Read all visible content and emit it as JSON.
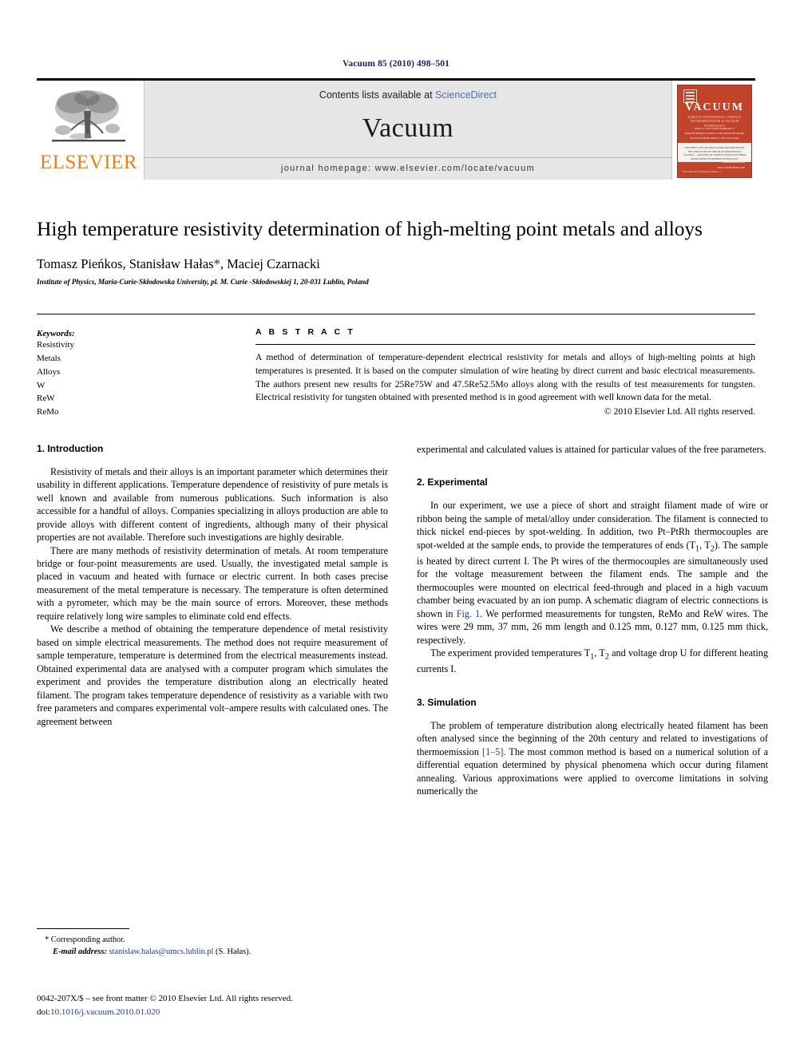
{
  "running_head": "Vacuum 85 (2010) 498–501",
  "masthead": {
    "elsevier_wordmark": "ELSEVIER",
    "contents_prefix": "Contents lists available at ",
    "sciencedirect": "ScienceDirect",
    "journal_title": "Vacuum",
    "homepage": "journal homepage: www.elsevier.com/locate/vacuum",
    "cover": {
      "title": "VACUUM",
      "subtitle": "SURFACE ENGINEERING, SURFACE INSTRUMENTATION & VACUUM TECHNOLOGY",
      "editors": "JOHN A. COLLIGON    BARBARA J. PROKHORENKO    DAVID P. FIELDMAN    RICHARD BLOODWORTH    DENIS J. MCWILLIAMS",
      "blurb": "THE EFFECT OF IONS AND PLASMA PARAMETERS ON THE STRUCTURE OF THIN FILMS DEPOSITED IN VACUUM — ANALYSIS OF SURFACE STATES AND THEIR APPLICATIONS IN MODERN TECHNOLOGY",
      "available_label": "Available online at",
      "sciencedirect": "ScienceDirect",
      "site": "www.sciencedirect.com",
      "issn_line": "ISSN 0042-207X    Volume 85    Number 4"
    }
  },
  "article": {
    "title": "High temperature resistivity determination of high-melting point metals and alloys",
    "authors_pre": "Tomasz Pieńkos, Stanisław Hałas",
    "author_star": "*",
    "authors_post": ", Maciej Czarnacki",
    "affiliation": "Institute of Physics, Maria-Curie-Skłodowska University, pl. M. Curie -Skłodowskiej 1, 20-031 Lublin, Poland"
  },
  "keywords": {
    "heading": "Keywords:",
    "items": [
      "Resistivity",
      "Metals",
      "Alloys",
      "W",
      "ReW",
      "ReMo"
    ]
  },
  "abstract": {
    "heading": "A B S T R A C T",
    "text": "A method of determination of temperature-dependent electrical resistivity for metals and alloys of high-melting points at high temperatures is presented. It is based on the computer simulation of wire heating by direct current and basic electrical measurements. The authors present new results for 25Re75W and 47.5Re52.5Mo alloys along with the results of test measurements for tungsten. Electrical resistivity for tungsten obtained with presented method is in good agreement with well known data for the metal.",
    "copyright": "© 2010 Elsevier Ltd. All rights reserved."
  },
  "sections": {
    "introduction": {
      "heading": "1. Introduction",
      "paragraphs": [
        "Resistivity of metals and their alloys is an important parameter which determines their usability in different applications. Temperature dependence of resistivity of pure metals is well known and available from numerous publications. Such information is also accessible for a handful of alloys. Companies specializing in alloys production are able to provide alloys with different content of ingredients, although many of their physical properties are not available. Therefore such investigations are highly desirable.",
        "There are many methods of resistivity determination of metals. At room temperature bridge or four-point measurements are used. Usually, the investigated metal sample is placed in vacuum and heated with furnace or electric current. In both cases precise measurement of the metal temperature is necessary. The temperature is often determined with a pyrometer, which may be the main source of errors. Moreover, these methods require relatively long wire samples to eliminate cold end effects.",
        "We describe a method of obtaining the temperature dependence of metal resistivity based on simple electrical measurements. The method does not require measurement of sample temperature, temperature is determined from the electrical measurements instead. Obtained experimental data are analysed with a computer program which simulates the experiment and provides the temperature distribution along an electrically heated filament. The program takes temperature dependence of resistivity as a variable with two free parameters and compares experimental volt–ampere results with calculated ones. The agreement between"
      ]
    },
    "intro_continued": "experimental and calculated values is attained for particular values of the free parameters.",
    "experimental": {
      "heading": "2. Experimental",
      "para1_a": "In our experiment, we use a piece of short and straight filament made of wire or ribbon being the sample of metal/alloy under consideration. The filament is connected to thick nickel end-pieces by spot-welding. In addition, two Pt–PtRh thermocouples are spot-welded at the sample ends, to provide the temperatures of ends (T",
      "sub1": "1",
      "para1_b": ", T",
      "sub2": "2",
      "para1_c": "). The sample is heated by direct current I. The Pt wires of the thermocouples are simultaneously used for the voltage measurement between the filament ends. The sample and the thermocouples were mounted on electrical feed-through and placed in a high vacuum chamber being evacuated by an ion pump. A schematic diagram of electric connections is shown in ",
      "fig_link": "Fig. 1",
      "para1_d": ". We performed measurements for tungsten, ReMo and ReW wires. The wires were 29 mm, 37 mm, 26 mm length and 0.125 mm, 0.127 mm, 0.125 mm thick, respectively.",
      "para2_a": "The experiment provided temperatures T",
      "para2_sub1": "1",
      "para2_b": ", T",
      "para2_sub2": "2",
      "para2_c": " and voltage drop U for different heating currents I."
    },
    "simulation": {
      "heading": "3. Simulation",
      "para_a": "The problem of temperature distribution along electrically heated filament has been often analysed since the beginning of the 20th century and related to investigations of thermoemission ",
      "cite_link": "[1–5]",
      "para_b": ". The most common method is based on a numerical solution of a differential equation determined by physical phenomena which occur during filament annealing. Various approximations were applied to overcome limitations in solving numerically the"
    }
  },
  "footnote": {
    "corresponding": "* Corresponding author.",
    "email_label": "E-mail address:",
    "email": "stanislaw.halas@umcs.lublin.pl",
    "email_suffix": "(S. Hałas)."
  },
  "footer": {
    "issn_line": "0042-207X/$ – see front matter © 2010 Elsevier Ltd. All rights reserved.",
    "doi_label": "doi:",
    "doi": "10.1016/j.vacuum.2010.01.020"
  },
  "colors": {
    "link": "#1a3c9c",
    "sciencedirect": "#4a6fb5",
    "elsevier_orange": "#f07f13",
    "cover_red": "#c0432a",
    "running_head": "#1a1a6e"
  }
}
